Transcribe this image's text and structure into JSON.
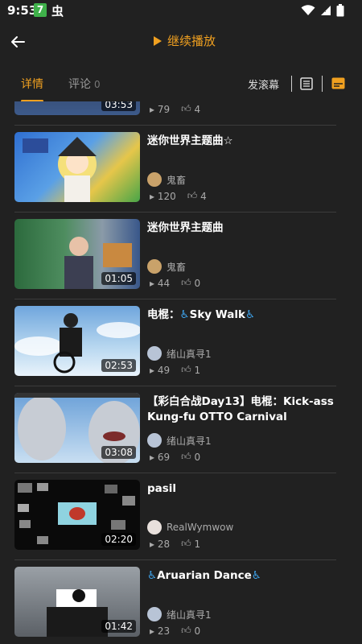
{
  "status_bar": {
    "time": "9:53",
    "notif_badge": "7",
    "notif_glyph": "虫"
  },
  "header": {
    "continue_label": "继续播放"
  },
  "tabs": {
    "details": "详情",
    "comments": "评论",
    "comment_count": "0",
    "danmaku_label": "发滚幕"
  },
  "colors": {
    "accent": "#f0a020",
    "background": "#212121",
    "link_blue": "#3fa9f5"
  },
  "items": [
    {
      "title": "",
      "author": "",
      "duration": "03:53",
      "views": "79",
      "likes": "4"
    },
    {
      "title": "迷你世界主题曲☆",
      "author": "鬼畜",
      "duration": "",
      "views": "120",
      "likes": "4"
    },
    {
      "title": "迷你世界主题曲",
      "author": "鬼畜",
      "duration": "01:05",
      "views": "44",
      "likes": "0"
    },
    {
      "title_prefix": "电棍：",
      "title_icon": "♿",
      "title_main": "Sky Walk",
      "title_suffix_icon": "♿",
      "author": "绪山真寻1",
      "duration": "02:53",
      "views": "49",
      "likes": "1"
    },
    {
      "title": "【彩白合战Day13】电棍：Kick-ass Kung-fu OTTO Carnival",
      "author": "绪山真寻1",
      "duration": "03:08",
      "views": "69",
      "likes": "0"
    },
    {
      "title": "pasil",
      "author": "RealWymwow",
      "duration": "02:20",
      "views": "28",
      "likes": "1"
    },
    {
      "title_prefix": "",
      "title_icon": "♿",
      "title_main": "Aruarian Dance",
      "title_suffix_icon": "♿",
      "author": "绪山真寻1",
      "duration": "01:42",
      "views": "23",
      "likes": "0"
    }
  ]
}
